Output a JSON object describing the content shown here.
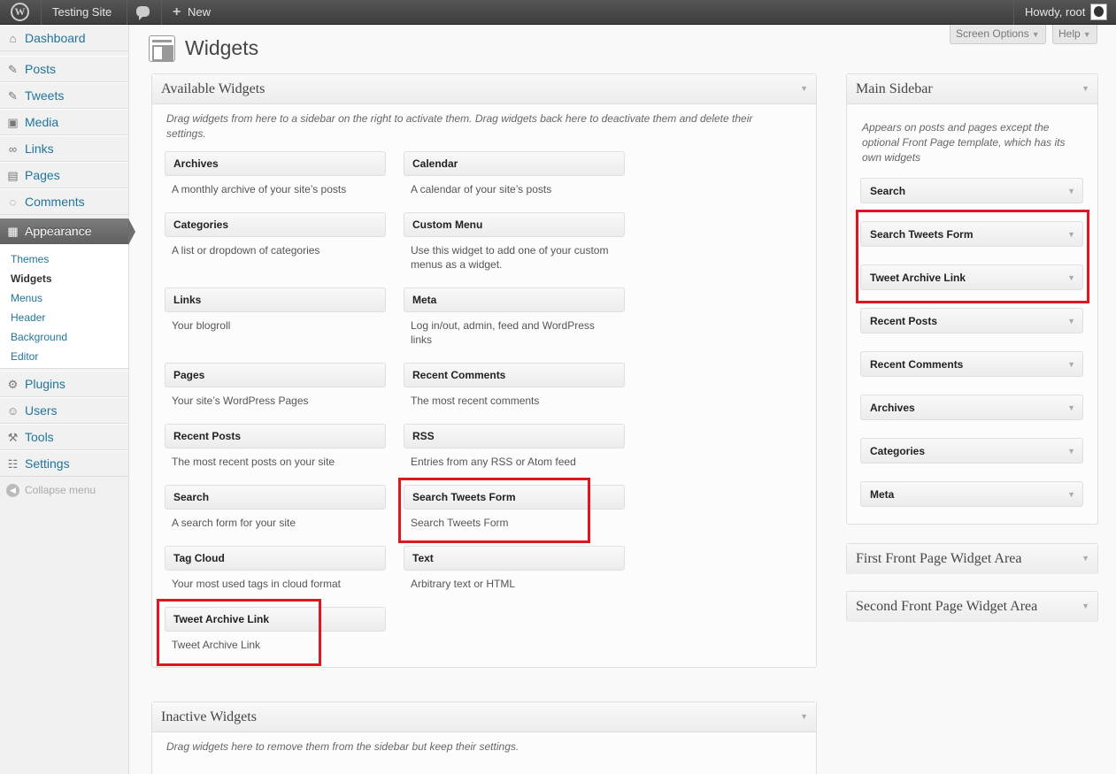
{
  "adminbar": {
    "site_name": "Testing Site",
    "new_label": "New",
    "howdy": "Howdy, root"
  },
  "menu": {
    "items": [
      {
        "label": "Dashboard",
        "icon": "dashboard-icon"
      },
      {
        "label": "Posts",
        "icon": "pin-icon"
      },
      {
        "label": "Tweets",
        "icon": "pin-icon"
      },
      {
        "label": "Media",
        "icon": "media-icon"
      },
      {
        "label": "Links",
        "icon": "link-icon"
      },
      {
        "label": "Pages",
        "icon": "page-icon"
      },
      {
        "label": "Comments",
        "icon": "comment-icon"
      },
      {
        "label": "Appearance",
        "icon": "appearance-icon"
      },
      {
        "label": "Plugins",
        "icon": "plugin-icon"
      },
      {
        "label": "Users",
        "icon": "users-icon"
      },
      {
        "label": "Tools",
        "icon": "tools-icon"
      },
      {
        "label": "Settings",
        "icon": "settings-icon"
      }
    ],
    "submenu": [
      "Themes",
      "Widgets",
      "Menus",
      "Header",
      "Background",
      "Editor"
    ],
    "collapse": "Collapse menu"
  },
  "header": {
    "title": "Widgets",
    "screen_options": "Screen Options",
    "help": "Help"
  },
  "available": {
    "title": "Available Widgets",
    "description": "Drag widgets from here to a sidebar on the right to activate them. Drag widgets back here to deactivate them and delete their settings.",
    "widgets": [
      {
        "title": "Archives",
        "desc": "A monthly archive of your site’s posts"
      },
      {
        "title": "Calendar",
        "desc": "A calendar of your site’s posts"
      },
      {
        "title": "Categories",
        "desc": "A list or dropdown of categories"
      },
      {
        "title": "Custom Menu",
        "desc": "Use this widget to add one of your custom menus as a widget."
      },
      {
        "title": "Links",
        "desc": "Your blogroll"
      },
      {
        "title": "Meta",
        "desc": "Log in/out, admin, feed and WordPress links"
      },
      {
        "title": "Pages",
        "desc": "Your site’s WordPress Pages"
      },
      {
        "title": "Recent Comments",
        "desc": "The most recent comments"
      },
      {
        "title": "Recent Posts",
        "desc": "The most recent posts on your site"
      },
      {
        "title": "RSS",
        "desc": "Entries from any RSS or Atom feed"
      },
      {
        "title": "Search",
        "desc": "A search form for your site"
      },
      {
        "title": "Search Tweets Form",
        "desc": "Search Tweets Form"
      },
      {
        "title": "Tag Cloud",
        "desc": "Your most used tags in cloud format"
      },
      {
        "title": "Text",
        "desc": "Arbitrary text or HTML"
      },
      {
        "title": "Tweet Archive Link",
        "desc": "Tweet Archive Link"
      }
    ]
  },
  "inactive": {
    "title": "Inactive Widgets",
    "description": "Drag widgets here to remove them from the sidebar but keep their settings."
  },
  "main_sidebar": {
    "title": "Main Sidebar",
    "description": "Appears on posts and pages except the optional Front Page template, which has its own widgets",
    "widgets": [
      "Search",
      "Search Tweets Form",
      "Tweet Archive Link",
      "Recent Posts",
      "Recent Comments",
      "Archives",
      "Categories",
      "Meta"
    ]
  },
  "areas": {
    "first": "First Front Page Widget Area",
    "second": "Second Front Page Widget Area"
  },
  "colors": {
    "highlight": "#e0161e",
    "link": "#21759b"
  }
}
